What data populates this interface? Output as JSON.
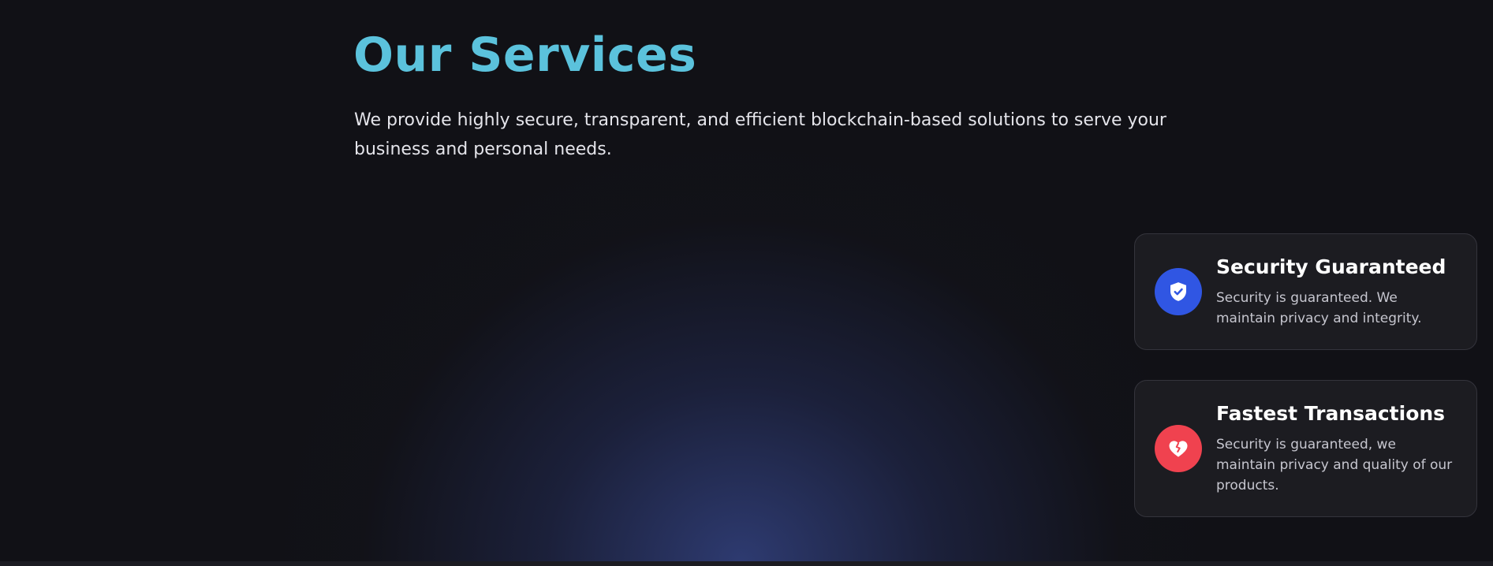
{
  "services": {
    "title": "Our Services",
    "subtitle": "We provide highly secure, transparent, and efficient blockchain-based solutions to serve your business and personal needs.",
    "cards": [
      {
        "title": "Security Guaranteed",
        "description": "Security is guaranteed. We maintain privacy and integrity.",
        "icon": "shield-check-icon",
        "icon_color": "#3056e3"
      },
      {
        "title": "Fastest Transactions",
        "description": "Security is guaranteed, we maintain privacy and quality of our products.",
        "icon": "heart-icon",
        "icon_color": "#f0424f"
      }
    ]
  },
  "colors": {
    "background": "#111116",
    "title": "#5bc2dc",
    "card_background": "#1c1c21",
    "glow": "#303e78"
  }
}
